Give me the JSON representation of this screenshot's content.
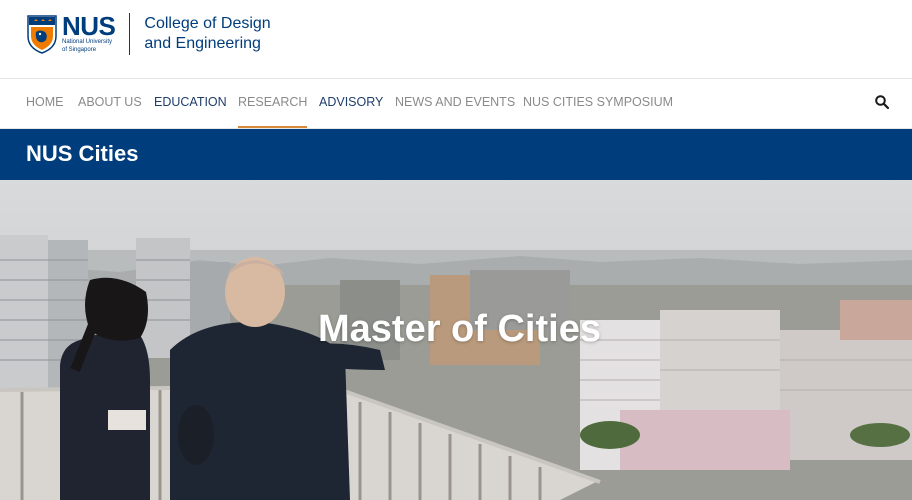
{
  "header": {
    "logo_word": "NUS",
    "logo_subtitle_line1": "National University",
    "logo_subtitle_line2": "of Singapore",
    "college_line1": "College of Design",
    "college_line2": "and Engineering"
  },
  "nav": {
    "items": [
      {
        "label": "HOME"
      },
      {
        "label": "ABOUT US"
      },
      {
        "label": "EDUCATION"
      },
      {
        "label": "RESEARCH"
      },
      {
        "label": "ADVISORY"
      },
      {
        "label": "NEWS AND EVENTS"
      },
      {
        "label": "NUS CITIES SYMPOSIUM"
      }
    ],
    "search_icon": "search-icon"
  },
  "banner": {
    "title": "NUS Cities"
  },
  "hero": {
    "title": "Master of Cities"
  },
  "colors": {
    "brand_blue": "#003d7c",
    "nav_active": "#1f3d6b",
    "nav_underline": "#d58a3a",
    "nav_default": "#8a8a8a"
  }
}
